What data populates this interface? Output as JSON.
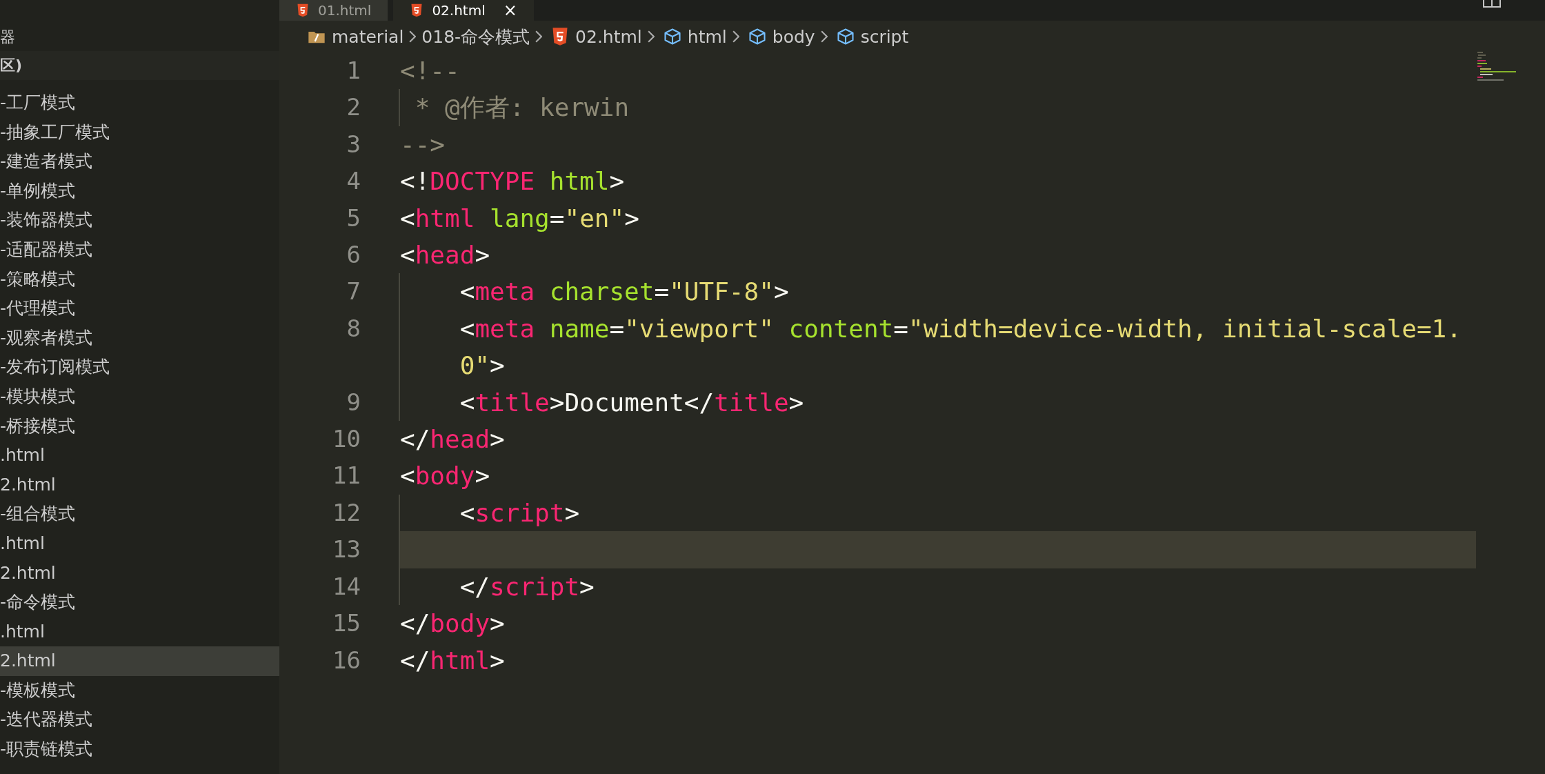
{
  "tabs": [
    {
      "label": "01.html",
      "selected": false
    },
    {
      "label": "02.html",
      "selected": true,
      "close": "×"
    }
  ],
  "sidebar": {
    "headers": [
      "器",
      "区)"
    ],
    "items": [
      {
        "label": "-工厂模式",
        "selected": false
      },
      {
        "label": "-抽象工厂模式",
        "selected": false
      },
      {
        "label": "-建造者模式",
        "selected": false
      },
      {
        "label": "-单例模式",
        "selected": false
      },
      {
        "label": "-装饰器模式",
        "selected": false
      },
      {
        "label": "-适配器模式",
        "selected": false
      },
      {
        "label": "-策略模式",
        "selected": false
      },
      {
        "label": "-代理模式",
        "selected": false
      },
      {
        "label": "-观察者模式",
        "selected": false
      },
      {
        "label": "-发布订阅模式",
        "selected": false
      },
      {
        "label": "-模块模式",
        "selected": false
      },
      {
        "label": "-桥接模式",
        "selected": false
      },
      {
        "label": ".html",
        "selected": false
      },
      {
        "label": "2.html",
        "selected": false
      },
      {
        "label": "-组合模式",
        "selected": false
      },
      {
        "label": ".html",
        "selected": false
      },
      {
        "label": "2.html",
        "selected": false
      },
      {
        "label": "-命令模式",
        "selected": false
      },
      {
        "label": ".html",
        "selected": false
      },
      {
        "label": "2.html",
        "selected": true
      },
      {
        "label": "-模板模式",
        "selected": false
      },
      {
        "label": "-迭代器模式",
        "selected": false
      },
      {
        "label": "-职责链模式",
        "selected": false
      }
    ]
  },
  "breadcrumb": [
    {
      "kind": "folder",
      "label": "material"
    },
    {
      "kind": "plain",
      "label": "018-命令模式"
    },
    {
      "kind": "html",
      "label": "02.html"
    },
    {
      "kind": "element",
      "label": "html"
    },
    {
      "kind": "element",
      "label": "body"
    },
    {
      "kind": "element",
      "label": "script"
    }
  ],
  "editor": {
    "lines": [
      {
        "number": "1",
        "indented": false,
        "guide": false,
        "current": false,
        "tokens": [
          {
            "kind": "comment",
            "t": "<!--"
          }
        ]
      },
      {
        "number": "2",
        "indented": false,
        "guide": true,
        "current": false,
        "tokens": [
          {
            "kind": "comment",
            "t": " * @作者: kerwin"
          }
        ]
      },
      {
        "number": "3",
        "indented": false,
        "guide": false,
        "current": false,
        "tokens": [
          {
            "kind": "comment",
            "t": "-->"
          }
        ]
      },
      {
        "number": "4",
        "indented": false,
        "guide": false,
        "current": false,
        "tokens": [
          {
            "kind": "punct",
            "t": "<!"
          },
          {
            "kind": "tag",
            "t": "DOCTYPE"
          },
          {
            "kind": "attr",
            "t": " html"
          },
          {
            "kind": "punct",
            "t": ">"
          }
        ]
      },
      {
        "number": "5",
        "indented": false,
        "guide": false,
        "current": false,
        "tokens": [
          {
            "kind": "punct",
            "t": "<"
          },
          {
            "kind": "tag",
            "t": "html"
          },
          {
            "kind": "attr",
            "t": " lang"
          },
          {
            "kind": "punct",
            "t": "="
          },
          {
            "kind": "string",
            "t": "\"en\""
          },
          {
            "kind": "punct",
            "t": ">"
          }
        ]
      },
      {
        "number": "6",
        "indented": false,
        "guide": false,
        "current": false,
        "tokens": [
          {
            "kind": "punct",
            "t": "<"
          },
          {
            "kind": "tag",
            "t": "head"
          },
          {
            "kind": "punct",
            "t": ">"
          }
        ]
      },
      {
        "number": "7",
        "indented": true,
        "guide": true,
        "current": false,
        "tokens": [
          {
            "kind": "punct",
            "t": "<"
          },
          {
            "kind": "tag",
            "t": "meta"
          },
          {
            "kind": "attr",
            "t": " charset"
          },
          {
            "kind": "punct",
            "t": "="
          },
          {
            "kind": "string",
            "t": "\"UTF-8\""
          },
          {
            "kind": "punct",
            "t": ">"
          }
        ]
      },
      {
        "number": "8",
        "indented": true,
        "guide": true,
        "current": false,
        "tokens": [
          {
            "kind": "punct",
            "t": "<"
          },
          {
            "kind": "tag",
            "t": "meta"
          },
          {
            "kind": "attr",
            "t": " name"
          },
          {
            "kind": "punct",
            "t": "="
          },
          {
            "kind": "string",
            "t": "\"viewport\""
          },
          {
            "kind": "attr",
            "t": " content"
          },
          {
            "kind": "punct",
            "t": "="
          },
          {
            "kind": "string",
            "t": "\"width=device-width, initial-scale=1.0\""
          },
          {
            "kind": "punct",
            "t": ">"
          }
        ]
      },
      {
        "number": "9",
        "indented": true,
        "guide": true,
        "current": false,
        "tokens": [
          {
            "kind": "punct",
            "t": "<"
          },
          {
            "kind": "tag",
            "t": "title"
          },
          {
            "kind": "punct",
            "t": ">"
          },
          {
            "kind": "text",
            "t": "Document"
          },
          {
            "kind": "punct",
            "t": "</"
          },
          {
            "kind": "tag",
            "t": "title"
          },
          {
            "kind": "punct",
            "t": ">"
          }
        ]
      },
      {
        "number": "10",
        "indented": false,
        "guide": false,
        "current": false,
        "tokens": [
          {
            "kind": "punct",
            "t": "</"
          },
          {
            "kind": "tag",
            "t": "head"
          },
          {
            "kind": "punct",
            "t": ">"
          }
        ]
      },
      {
        "number": "11",
        "indented": false,
        "guide": false,
        "current": false,
        "tokens": [
          {
            "kind": "punct",
            "t": "<"
          },
          {
            "kind": "tag",
            "t": "body"
          },
          {
            "kind": "punct",
            "t": ">"
          }
        ]
      },
      {
        "number": "12",
        "indented": true,
        "guide": true,
        "current": false,
        "tokens": [
          {
            "kind": "punct",
            "t": "<"
          },
          {
            "kind": "tag",
            "t": "script"
          },
          {
            "kind": "punct",
            "t": ">"
          }
        ]
      },
      {
        "number": "13",
        "indented": true,
        "guide": true,
        "current": true
      },
      {
        "number": "14",
        "indented": true,
        "guide": true,
        "current": false,
        "tokens": [
          {
            "kind": "punct",
            "t": "</"
          },
          {
            "kind": "tag",
            "t": "script"
          },
          {
            "kind": "punct",
            "t": ">"
          }
        ]
      },
      {
        "number": "15",
        "indented": false,
        "guide": false,
        "current": false,
        "tokens": [
          {
            "kind": "punct",
            "t": "</"
          },
          {
            "kind": "tag",
            "t": "body"
          },
          {
            "kind": "punct",
            "t": ">"
          }
        ]
      },
      {
        "number": "16",
        "indented": false,
        "guide": false,
        "current": false,
        "tokens": [
          {
            "kind": "punct",
            "t": "</"
          },
          {
            "kind": "tag",
            "t": "html"
          },
          {
            "kind": "punct",
            "t": ">"
          }
        ]
      }
    ]
  }
}
